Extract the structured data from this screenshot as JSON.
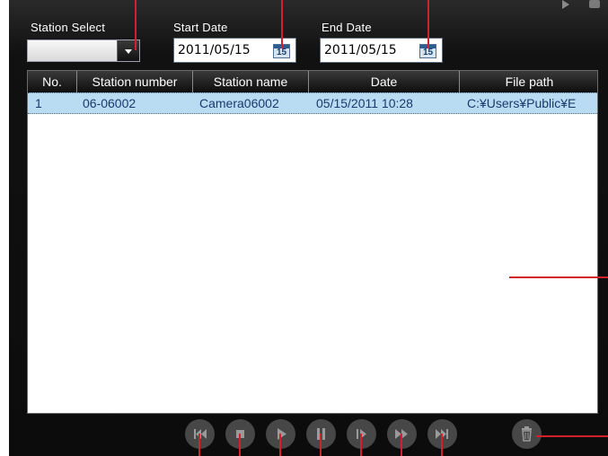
{
  "filters": {
    "station_select_label": "Station Select",
    "station_select_value": "",
    "start_date_label": "Start Date",
    "start_date_value": "2011/05/15",
    "end_date_label": "End Date",
    "end_date_value": "2011/05/15",
    "calendar_day": "15"
  },
  "table": {
    "columns": [
      "No.",
      "Station number",
      "Station name",
      "Date",
      "File path"
    ],
    "rows": [
      {
        "no": "1",
        "station_number": "06-06002",
        "station_name": "Camera06002",
        "date": "05/15/2011 10:28",
        "file_path": "C:¥Users¥Public¥E"
      }
    ]
  },
  "controls": {
    "buttons": [
      "skip-to-start",
      "stop",
      "play",
      "pause",
      "step-forward",
      "fast-forward",
      "skip-to-end"
    ],
    "delete_icon": "trash-icon"
  },
  "colors": {
    "selected_row": "#b9dcf2",
    "callout_line": "#d4202a",
    "background": "#111111"
  }
}
